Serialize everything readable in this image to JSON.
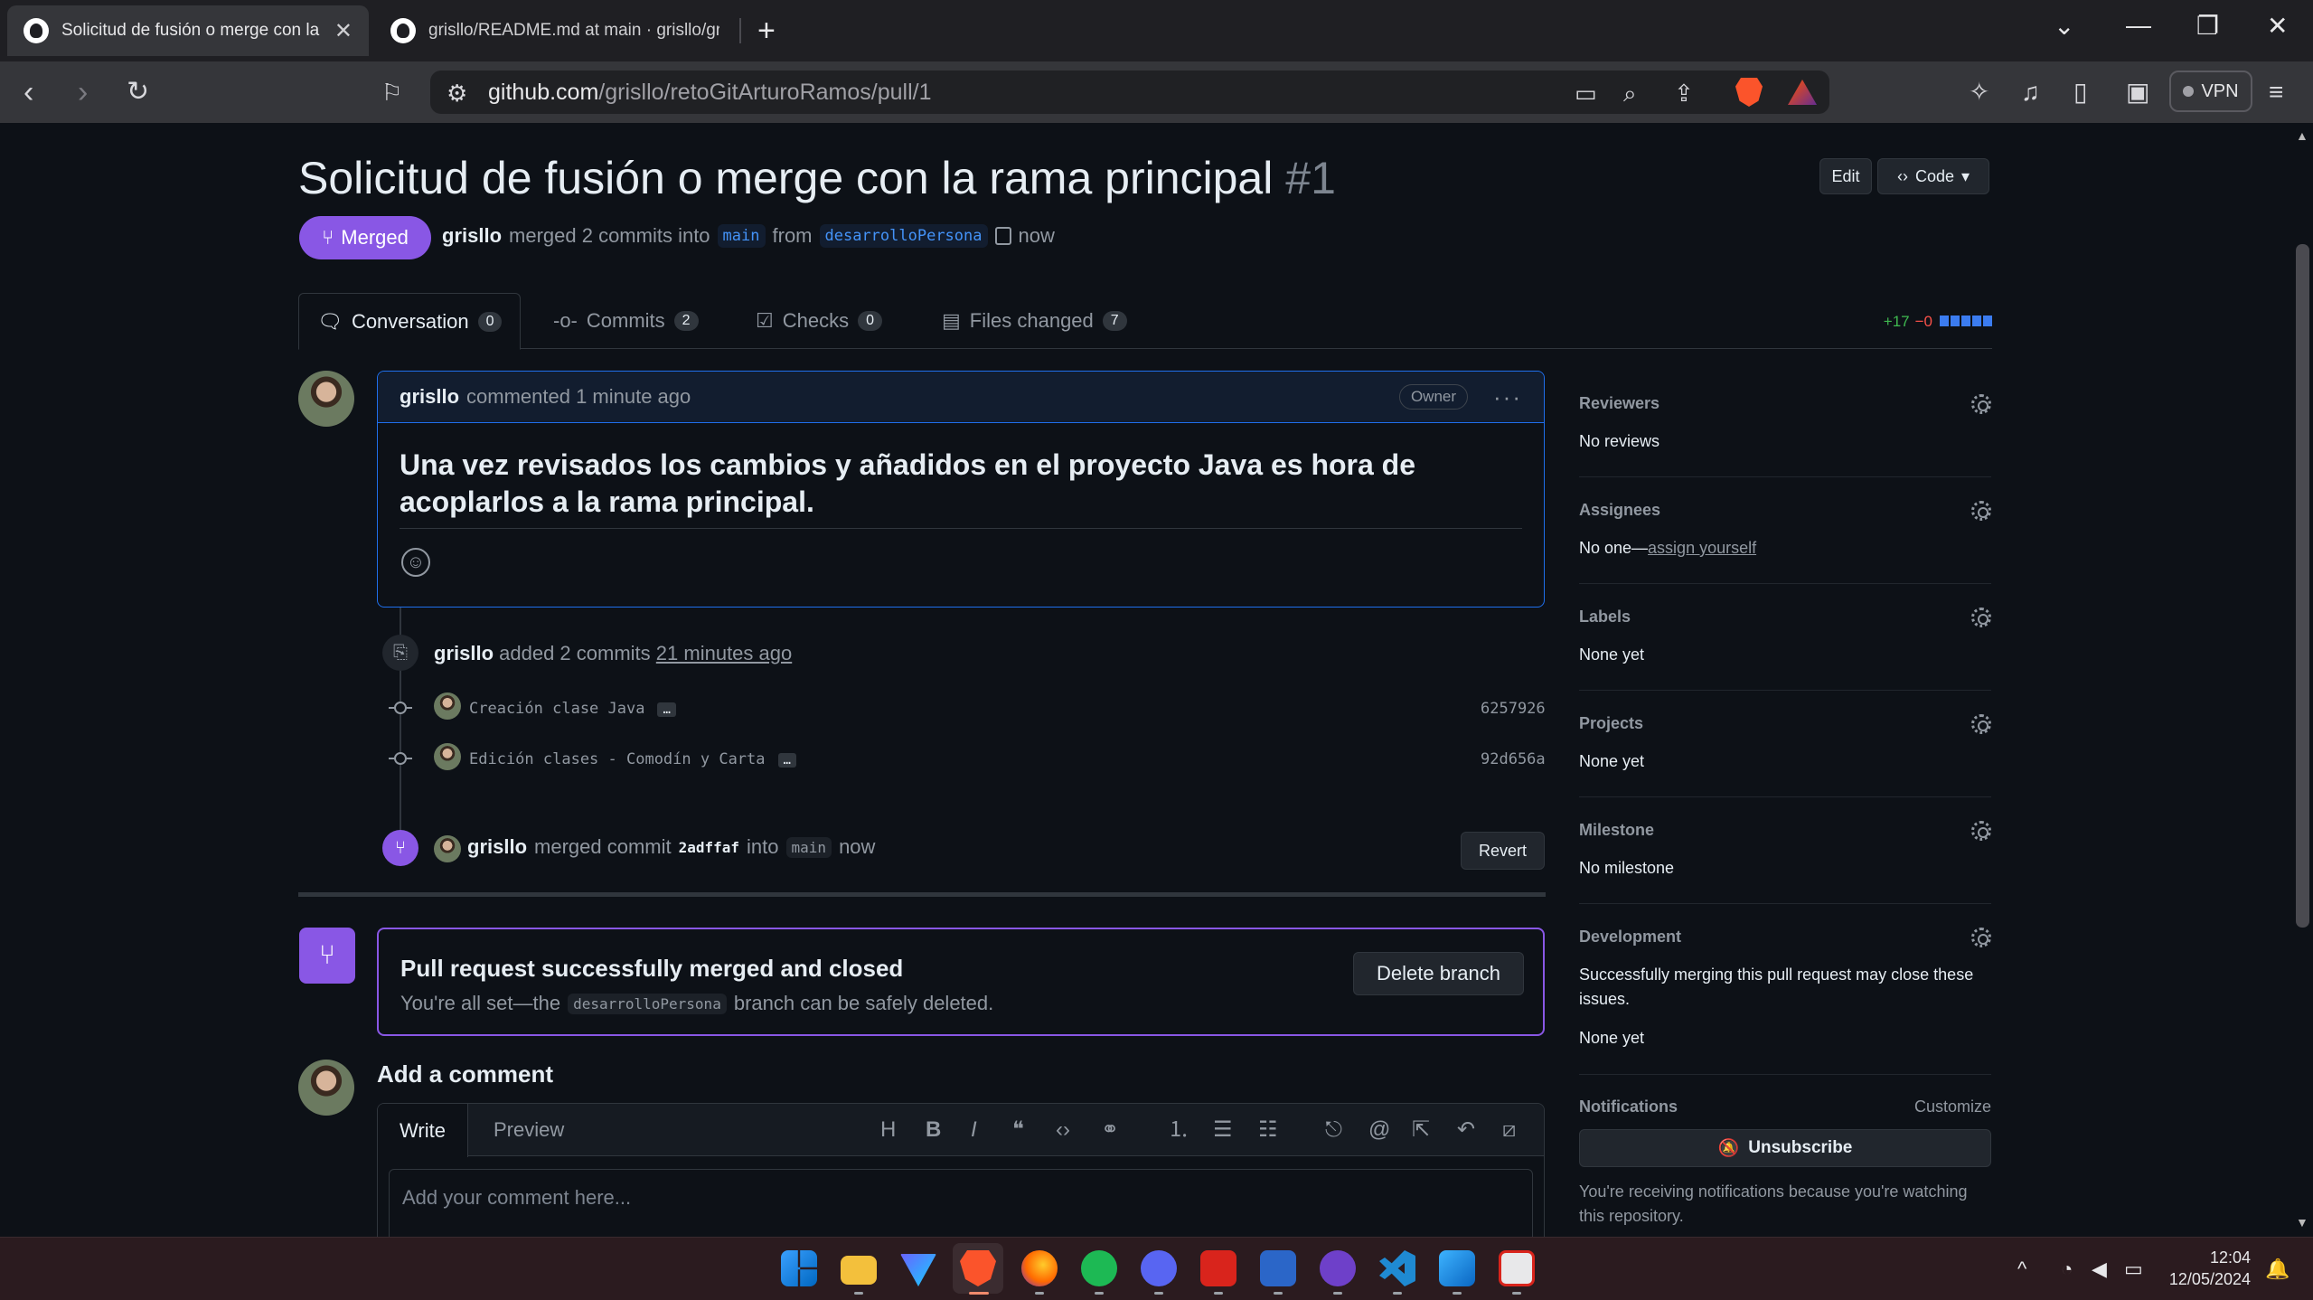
{
  "browser": {
    "tabs": [
      {
        "title": "Solicitud de fusión o merge con la"
      },
      {
        "title": "grisllo/README.md at main · grisllo/gris"
      }
    ],
    "url_host": "github.com",
    "url_path": "/grisllo/retoGitArturoRamos/pull/1",
    "vpn_label": "VPN"
  },
  "pr": {
    "title": "Solicitud de fusión o merge con la rama principal",
    "number": "#1",
    "edit_label": "Edit",
    "code_label": "Code",
    "state": "Merged",
    "author": "grisllo",
    "meta_text": "merged 2 commits into",
    "base_branch": "main",
    "from_text": "from",
    "head_branch": "desarrolloPersona",
    "time": "now"
  },
  "tabs": [
    {
      "label": "Conversation",
      "count": "0"
    },
    {
      "label": "Commits",
      "count": "2"
    },
    {
      "label": "Checks",
      "count": "0"
    },
    {
      "label": "Files changed",
      "count": "7"
    }
  ],
  "diffstat": {
    "additions": "+17",
    "deletions": "−0"
  },
  "comment": {
    "author": "grisllo",
    "action": "commented 1 minute ago",
    "badge": "Owner",
    "body": "Una vez revisados los cambios y añadidos en el proyecto Java es hora de acoplarlos a la rama principal."
  },
  "timeline": {
    "added_author": "grisllo",
    "added_text": "added 2 commits",
    "added_time": "21 minutes ago",
    "commits": [
      {
        "message": "Creación clase Java",
        "sha": "6257926"
      },
      {
        "message": "Edición clases - Comodín y Carta",
        "sha": "92d656a"
      }
    ],
    "merge_author": "grisllo",
    "merge_text": "merged commit",
    "merge_sha": "2adffaf",
    "merge_into": "into",
    "merge_branch": "main",
    "merge_time": "now",
    "revert_label": "Revert"
  },
  "merged_box": {
    "title": "Pull request successfully merged and closed",
    "sub_before": "You're all set—the",
    "branch": "desarrolloPersona",
    "sub_after": "branch can be safely deleted.",
    "delete_label": "Delete branch"
  },
  "add_comment": {
    "title": "Add a comment",
    "write_tab": "Write",
    "preview_tab": "Preview",
    "placeholder": "Add your comment here..."
  },
  "sidebar": {
    "reviewers": {
      "title": "Reviewers",
      "value": "No reviews"
    },
    "assignees": {
      "title": "Assignees",
      "value_prefix": "No one—",
      "link": "assign yourself"
    },
    "labels": {
      "title": "Labels",
      "value": "None yet"
    },
    "projects": {
      "title": "Projects",
      "value": "None yet"
    },
    "milestone": {
      "title": "Milestone",
      "value": "No milestone"
    },
    "development": {
      "title": "Development",
      "desc": "Successfully merging this pull request may close these issues.",
      "value": "None yet"
    },
    "notifications": {
      "title": "Notifications",
      "customize": "Customize",
      "button": "Unsubscribe",
      "note": "You're receiving notifications because you're watching this repository."
    }
  },
  "taskbar": {
    "time": "12:04",
    "date": "12/05/2024"
  }
}
